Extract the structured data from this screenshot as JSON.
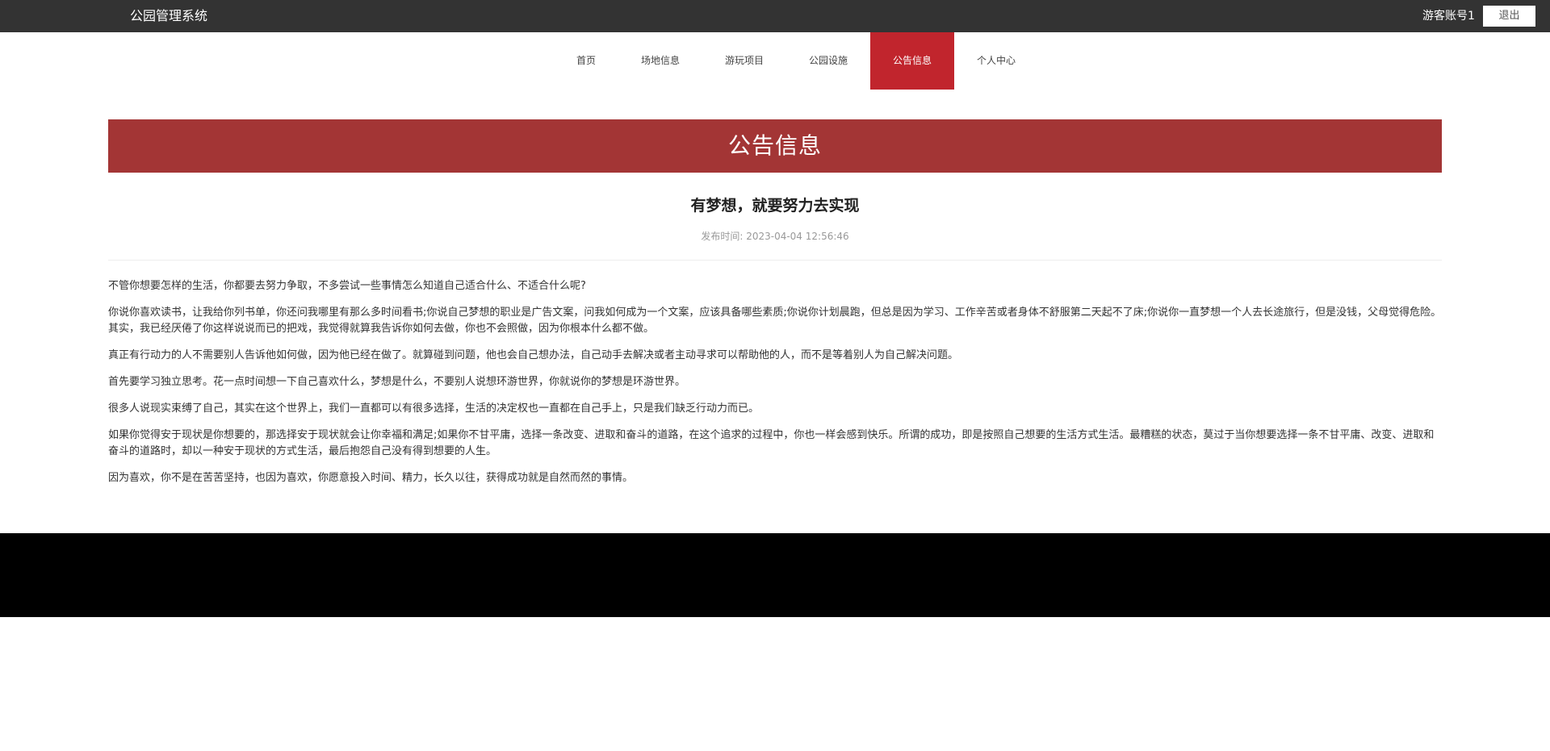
{
  "header": {
    "app_title": "公园管理系统",
    "account_name": "游客账号1",
    "logout_label": "退出"
  },
  "nav": {
    "items": [
      {
        "label": "首页"
      },
      {
        "label": "场地信息"
      },
      {
        "label": "游玩项目"
      },
      {
        "label": "公园设施"
      },
      {
        "label": "公告信息"
      },
      {
        "label": "个人中心"
      }
    ],
    "active_index": 4
  },
  "page": {
    "banner_title": "公告信息"
  },
  "article": {
    "title": "有梦想，就要努力去实现",
    "publish_label": "发布时间:",
    "publish_time": "2023-04-04 12:56:46",
    "paragraphs": [
      "不管你想要怎样的生活，你都要去努力争取，不多尝试一些事情怎么知道自己适合什么、不适合什么呢?",
      "你说你喜欢读书，让我给你列书单，你还问我哪里有那么多时间看书;你说自己梦想的职业是广告文案，问我如何成为一个文案，应该具备哪些素质;你说你计划晨跑，但总是因为学习、工作辛苦或者身体不舒服第二天起不了床;你说你一直梦想一个人去长途旅行，但是没钱，父母觉得危险。其实，我已经厌倦了你这样说说而已的把戏，我觉得就算我告诉你如何去做，你也不会照做，因为你根本什么都不做。",
      "真正有行动力的人不需要别人告诉他如何做，因为他已经在做了。就算碰到问题，他也会自己想办法，自己动手去解决或者主动寻求可以帮助他的人，而不是等着别人为自己解决问题。",
      "首先要学习独立思考。花一点时间想一下自己喜欢什么，梦想是什么，不要别人说想环游世界，你就说你的梦想是环游世界。",
      "很多人说现实束缚了自己，其实在这个世界上，我们一直都可以有很多选择，生活的决定权也一直都在自己手上，只是我们缺乏行动力而已。",
      "如果你觉得安于现状是你想要的，那选择安于现状就会让你幸福和满足;如果你不甘平庸，选择一条改变、进取和奋斗的道路，在这个追求的过程中，你也一样会感到快乐。所谓的成功，即是按照自己想要的生活方式生活。最糟糕的状态，莫过于当你想要选择一条不甘平庸、改变、进取和奋斗的道路时，却以一种安于现状的方式生活，最后抱怨自己没有得到想要的人生。",
      "因为喜欢，你不是在苦苦坚持，也因为喜欢，你愿意投入时间、精力，长久以往，获得成功就是自然而然的事情。"
    ]
  },
  "colors": {
    "topbar": "#333333",
    "nav_active": "#c1252d",
    "banner": "#a33535",
    "footer": "#000000"
  }
}
